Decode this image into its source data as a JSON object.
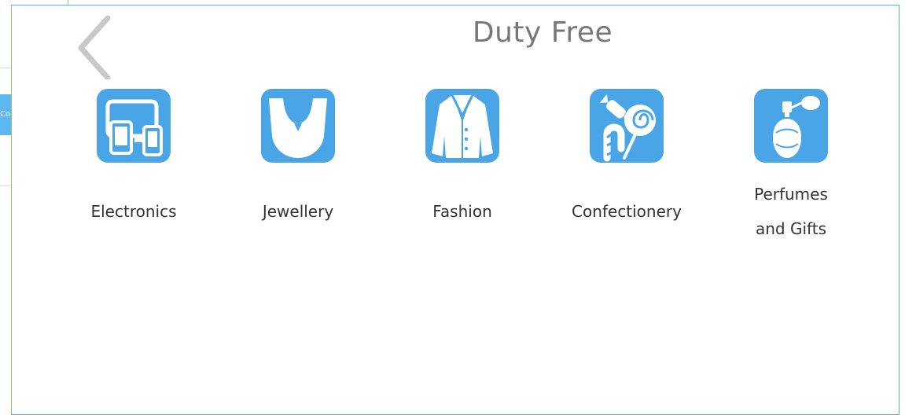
{
  "background": {
    "tab_label": "Co"
  },
  "header": {
    "title": "Duty Free",
    "back_icon": "chevron-left-icon"
  },
  "categories": [
    {
      "label": "Electronics",
      "icon": "devices-icon"
    },
    {
      "label": "Jewellery",
      "icon": "necklace-icon"
    },
    {
      "label": "Fashion",
      "icon": "coat-icon"
    },
    {
      "label": "Confectionery",
      "icon": "candy-icon"
    },
    {
      "label_line1": "Perfumes",
      "label_line2": "and Gifts",
      "icon": "perfume-icon"
    }
  ],
  "colors": {
    "accent": "#4aa5e6",
    "title": "#777777",
    "text": "#333333",
    "panel_border": "#4fb3e6"
  }
}
